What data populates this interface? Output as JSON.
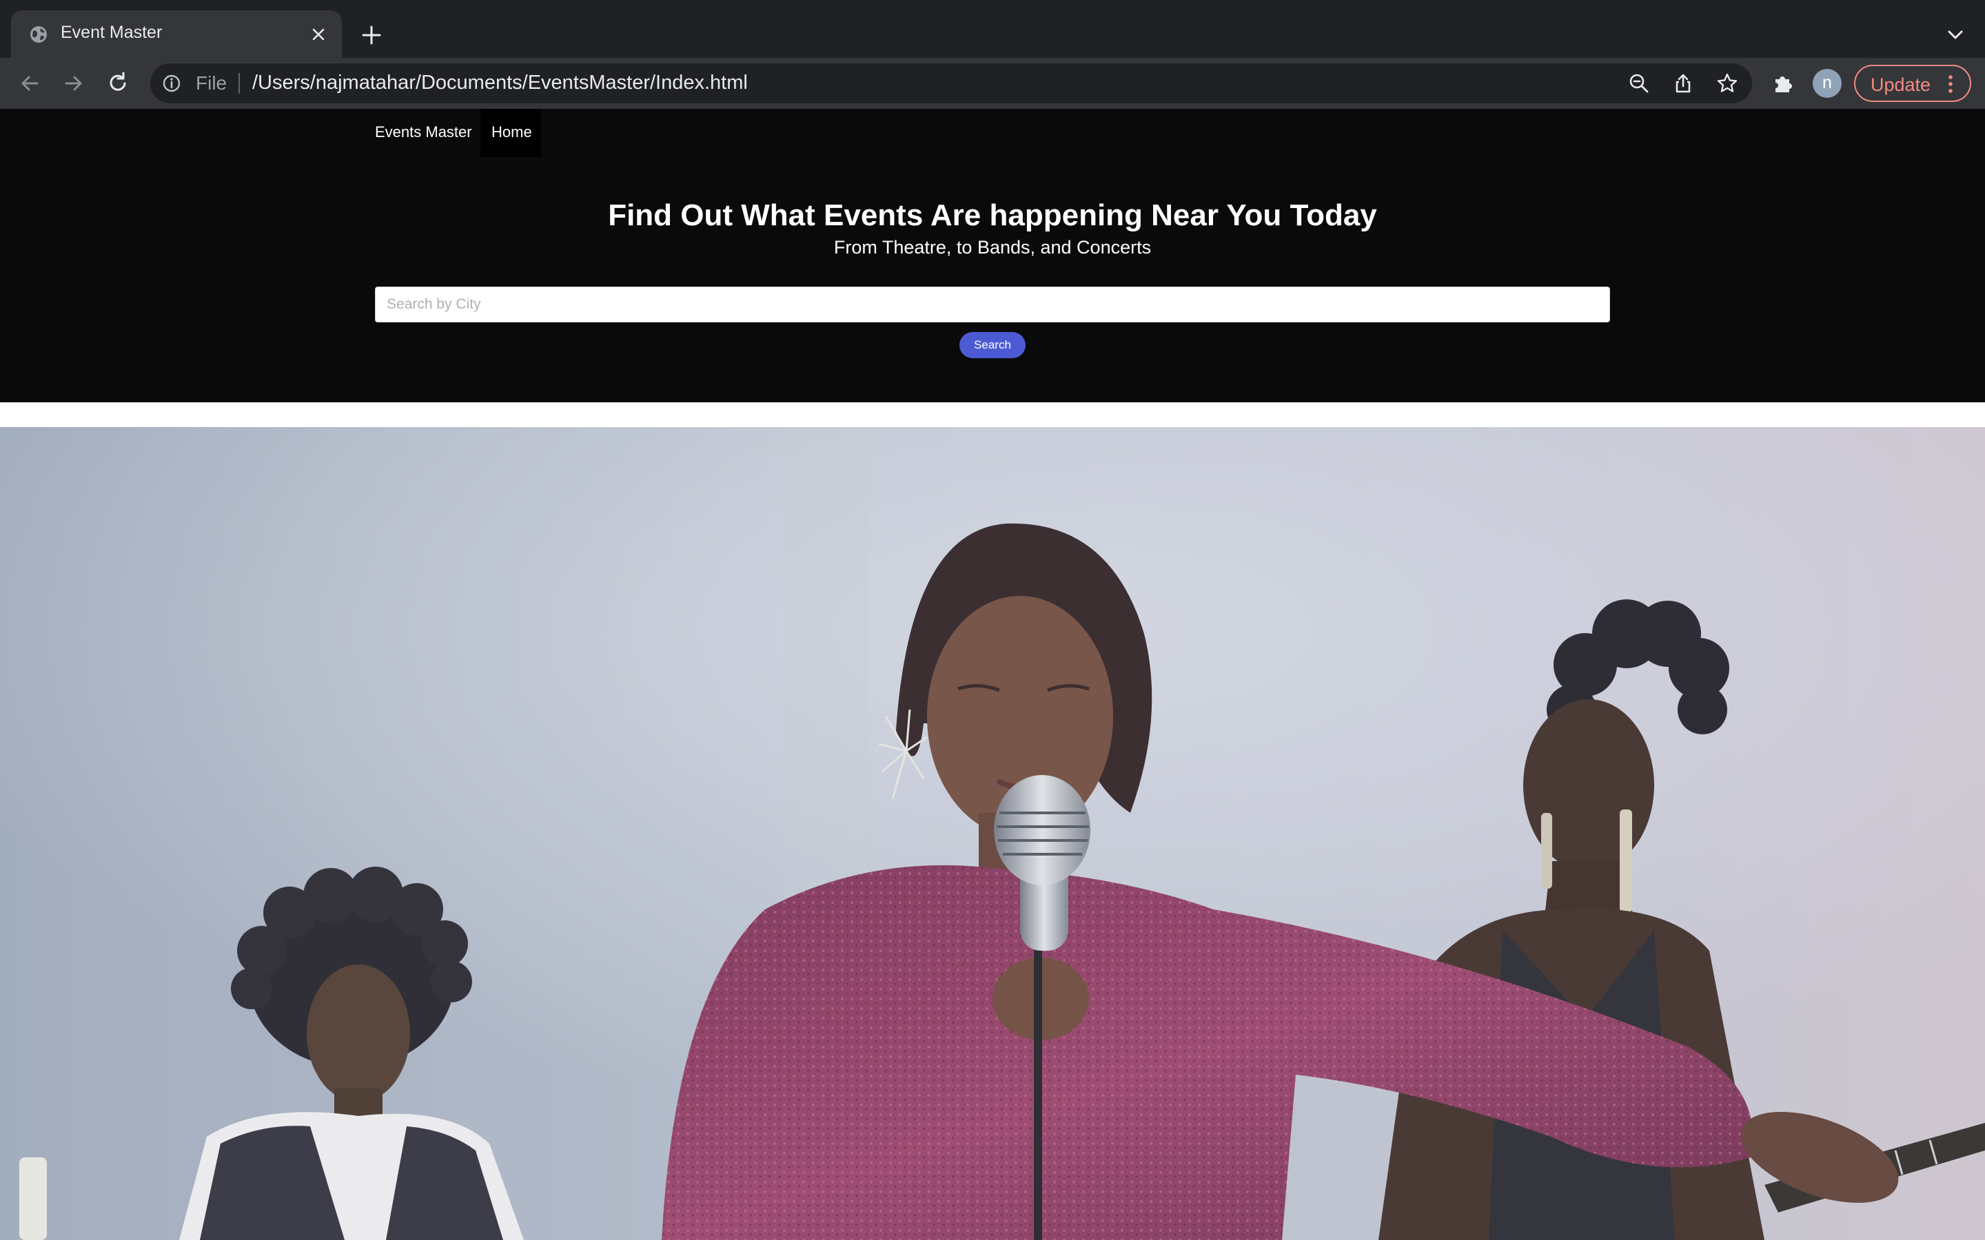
{
  "browser": {
    "tab_title": "Event Master",
    "address_scheme": "File",
    "address_url": "/Users/najmatahar/Documents/EventsMaster/Index.html",
    "profile_initial": "n",
    "update_label": "Update",
    "icons": {
      "favicon": "globe-icon",
      "tab_close": "close-icon",
      "new_tab": "plus-icon",
      "tab_list": "chevron-down-icon",
      "back": "arrow-left-icon",
      "forward": "arrow-right-icon",
      "reload": "reload-icon",
      "site_info": "info-icon",
      "zoom": "zoom-out-icon",
      "share": "share-icon",
      "bookmark": "star-icon",
      "extensions": "puzzle-icon",
      "menu": "kebab-menu-icon"
    }
  },
  "navbar": {
    "brand": "Events Master",
    "home": "Home"
  },
  "hero": {
    "headline": "Find Out What Events Are happening Near You Today",
    "subhead": "From Theatre, to Bands, and Concerts"
  },
  "search": {
    "placeholder": "Search by City",
    "value": "",
    "button_label": "Search"
  },
  "colors": {
    "chrome_dark": "#202124",
    "chrome_toolbar": "#35363a",
    "page_header_bg": "#0a0a0a",
    "search_button": "#4c5bd4",
    "update_accent": "#f28b82"
  },
  "hero_image": {
    "subject": "band performance photo"
  }
}
